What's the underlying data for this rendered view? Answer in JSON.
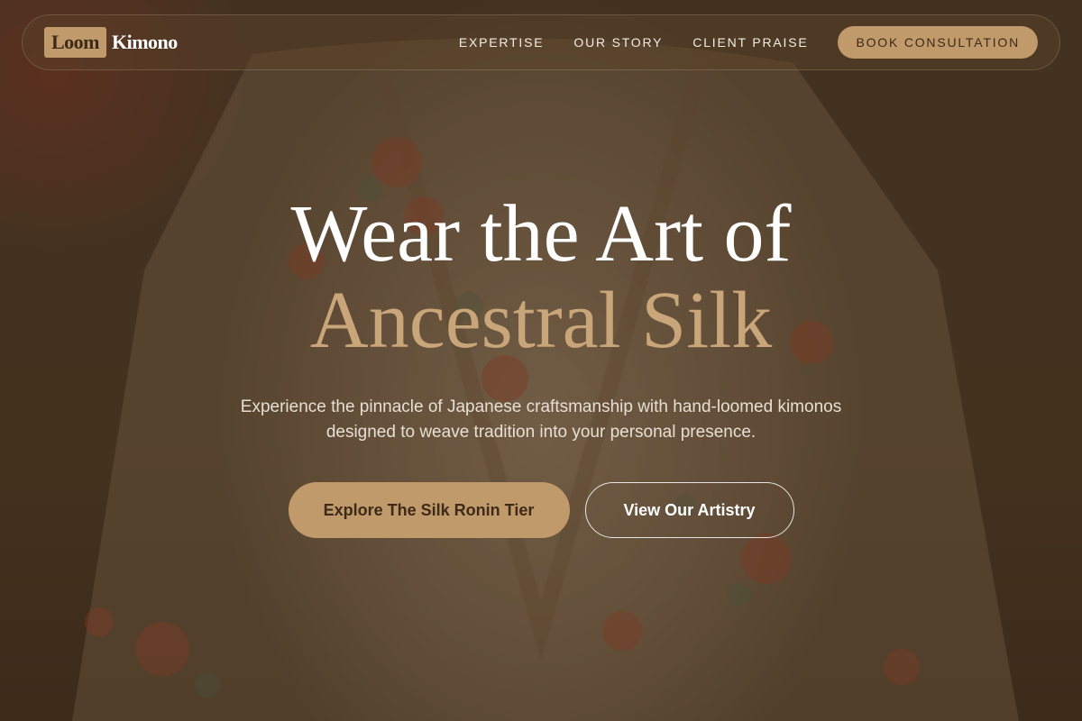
{
  "brand": {
    "logo_box": "Loom",
    "logo_text": "Kimono"
  },
  "nav": {
    "links": [
      {
        "label": "EXPERTISE"
      },
      {
        "label": "OUR STORY"
      },
      {
        "label": "CLIENT PRAISE"
      }
    ],
    "cta": "BOOK CONSULTATION"
  },
  "hero": {
    "headline_line1": "Wear the Art of",
    "headline_line2": "Ancestral Silk",
    "subtitle": "Experience the pinnacle of Japanese craftsmanship with hand-loomed kimonos designed to weave tradition into your personal presence.",
    "primary_button": "Explore The Silk Ronin Tier",
    "secondary_button": "View Our Artistry"
  },
  "colors": {
    "accent": "#c19a6b",
    "headline_accent": "#c9a57a",
    "background": "#4a3622"
  }
}
